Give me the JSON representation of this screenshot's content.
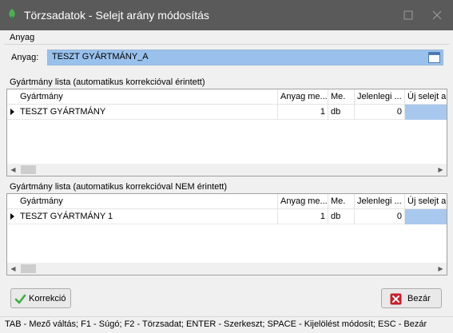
{
  "window": {
    "title": "Törzsadatok - Selejt arány módosítás",
    "icon": "green-leaf-icon",
    "controls": [
      "maximize-icon",
      "close-icon"
    ]
  },
  "anyag_group": {
    "title": "Anyag",
    "field_label": "Anyag:",
    "field_value": "TESZT GYÁRTMÁNY_A"
  },
  "grid1": {
    "title": "Gyártmány lista (automatikus korrekcióval érintett)",
    "columns": [
      "Gyártmány",
      "Anyag me...",
      "Me.",
      "Jelenlegi ...",
      "Új selejt a..."
    ],
    "rows": [
      {
        "gyartmany": "TESZT GYÁRTMÁNY",
        "anyag_me": "1",
        "me": "db",
        "jelenlegi": "0",
        "uj_selejt": ""
      }
    ]
  },
  "grid2": {
    "title": "Gyártmány lista (automatikus korrekcióval NEM érintett)",
    "columns": [
      "Gyártmány",
      "Anyag me...",
      "Me.",
      "Jelenlegi ...",
      "Új selejt a..."
    ],
    "rows": [
      {
        "gyartmany": "TESZT GYÁRTMÁNY 1",
        "anyag_me": "1",
        "me": "db",
        "jelenlegi": "0",
        "uj_selejt": ""
      }
    ]
  },
  "buttons": {
    "korrekcio": "Korrekció",
    "bezar": "Bezár"
  },
  "statusbar": {
    "text": "TAB - Mező váltás; F1 - Súgó; F2 - Törzsadat; ENTER - Szerkeszt; SPACE - Kijelölést módosít; ESC - Bezár"
  },
  "colors": {
    "titlebar": "#5a5a5a",
    "selection": "#99c1ec",
    "accent_green": "#3cb043",
    "accent_red": "#c8202a"
  }
}
